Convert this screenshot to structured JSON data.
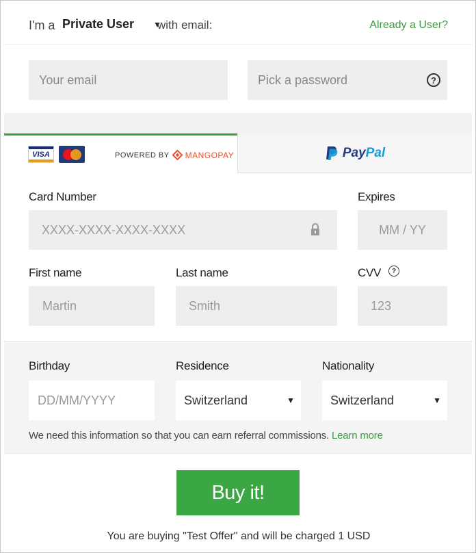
{
  "header": {
    "prefix": "I'm a",
    "user_type": "Private User",
    "suffix": "with email:",
    "login_link": "Already a User?"
  },
  "credentials": {
    "email_placeholder": "Your email",
    "password_placeholder": "Pick a password",
    "help_glyph": "?"
  },
  "tabs": {
    "card_brands": [
      "VISA",
      "MasterCard"
    ],
    "powered_by": "POWERED BY",
    "provider": "MANGOPAY",
    "paypal_part1": "Pay",
    "paypal_part2": "Pal"
  },
  "card": {
    "number_label": "Card Number",
    "number_placeholder": "XXXX-XXXX-XXXX-XXXX",
    "expires_label": "Expires",
    "expires_placeholder": "MM / YY",
    "first_name_label": "First name",
    "first_name_placeholder": "Martin",
    "last_name_label": "Last name",
    "last_name_placeholder": "Smith",
    "cvv_label": "CVV",
    "cvv_placeholder": "123",
    "cvv_help": "?"
  },
  "personal": {
    "birthday_label": "Birthday",
    "birthday_placeholder": "DD/MM/YYYY",
    "residence_label": "Residence",
    "residence_value": "Switzerland",
    "nationality_label": "Nationality",
    "nationality_value": "Switzerland",
    "note": "We need this information so that you can earn referral commissions.",
    "learn_more": "Learn more"
  },
  "purchase": {
    "button": "Buy it!",
    "summary": "You are buying \"Test Offer\" and will be charged 1 USD"
  },
  "colors": {
    "accent_green": "#3aa644",
    "link_green": "#3e9a3e",
    "paypal_dark": "#253b80",
    "paypal_light": "#179bd7",
    "mangopay_orange": "#e8512a"
  }
}
